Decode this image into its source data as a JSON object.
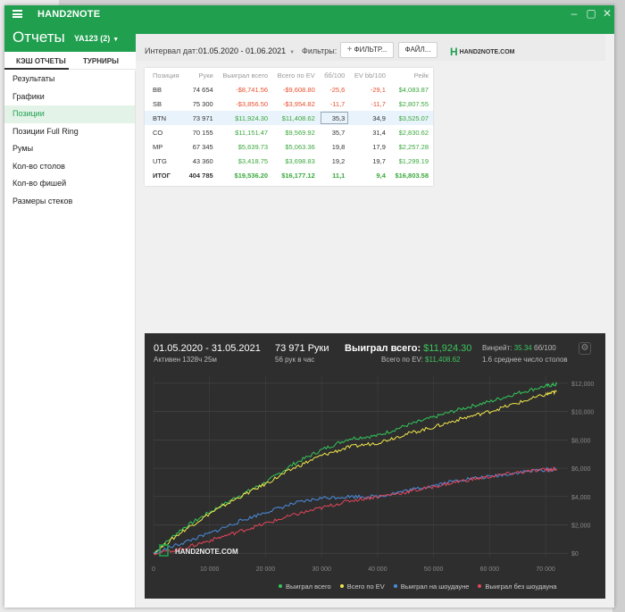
{
  "window": {
    "app_name": "HAND2NOTE",
    "page_title": "Отчеты",
    "account": "YA123 (2)",
    "controls": [
      "–",
      "▢",
      "✕"
    ]
  },
  "tabs": [
    {
      "label": "КЭШ ОТЧЕТЫ",
      "active": true
    },
    {
      "label": "ТУРНИРЫ",
      "active": false
    }
  ],
  "sidebar": {
    "items": [
      {
        "label": "Результаты",
        "active": false
      },
      {
        "label": "Графики",
        "active": false
      },
      {
        "label": "Позиции",
        "active": true
      },
      {
        "label": "Позиции Full Ring",
        "active": false
      },
      {
        "label": "Румы",
        "active": false
      },
      {
        "label": "Кол-во столов",
        "active": false
      },
      {
        "label": "Кол-во фишей",
        "active": false
      },
      {
        "label": "Размеры стеков",
        "active": false
      }
    ]
  },
  "toolbar": {
    "date_label": "Интервал дат:",
    "date_value": "01.05.2020 - 01.06.2021",
    "filters_label": "Фильтры:",
    "filter_button": "ФИЛЬТР...",
    "file_button": "ФАЙЛ...",
    "logo_text": "HAND2NOTE.COM"
  },
  "table": {
    "columns": [
      "Позиция",
      "Руки",
      "Выиграл всего",
      "Всего по EV",
      "бб/100",
      "EV bb/100",
      "Рейк"
    ],
    "rows": [
      [
        "BB",
        "74 654",
        "-$8,741.56",
        "-$9,608.80",
        "-25,6",
        "-29,1",
        "$4,083.87"
      ],
      [
        "SB",
        "75 300",
        "-$3,856.50",
        "-$3,954.82",
        "-11,7",
        "-11,7",
        "$2,807.55"
      ],
      [
        "BTN",
        "73 971",
        "$11,924.30",
        "$11,408.62",
        "35,3",
        "34,9",
        "$3,525.07"
      ],
      [
        "CO",
        "70 155",
        "$11,151.47",
        "$9,569.92",
        "35,7",
        "31,4",
        "$2,830.62"
      ],
      [
        "MP",
        "67 345",
        "$5,639.73",
        "$5,063.36",
        "19,8",
        "17,9",
        "$2,257.28"
      ],
      [
        "UTG",
        "43 360",
        "$3,418.75",
        "$3,698.83",
        "19,2",
        "19,7",
        "$1,299.19"
      ]
    ],
    "total": [
      "ИТОГ",
      "404 785",
      "$19,536.20",
      "$16,177.12",
      "11,1",
      "9,4",
      "$16,803.58"
    ],
    "selected_row": 2
  },
  "summary": {
    "period": "01.05.2020 - 31.05.2021",
    "active": "Активен 1328ч 25м",
    "hands": "73 971 Руки",
    "hands_per_hour": "56 рук в час",
    "won_label": "Выиграл всего:",
    "won_value": "$11,924.30",
    "ev_label": "Всего по EV:",
    "ev_value": "$11,408.62",
    "winrate_label": "Винрейт:",
    "winrate_value": "35.34",
    "winrate_unit": "бб/100",
    "tables": "1.6 среднее число столов",
    "watermark": "HAND2NOTE.COM"
  },
  "chart_data": {
    "type": "line",
    "x_ticks": [
      "0",
      "10 000",
      "20 000",
      "30 000",
      "40 000",
      "50 000",
      "60 000",
      "70 000"
    ],
    "y_ticks": [
      "$0",
      "$2,000",
      "$4,000",
      "$6,000",
      "$8,000",
      "$10,000",
      "$12,000"
    ],
    "xlim": [
      0,
      73971
    ],
    "ylim": [
      -300,
      12500
    ],
    "grid": true,
    "legend_position": "bottom-right",
    "series": [
      {
        "name": "Выиграл всего",
        "color": "#33c65a",
        "x": [
          0,
          5000,
          10000,
          15000,
          20000,
          25000,
          30000,
          35000,
          40000,
          45000,
          50000,
          55000,
          60000,
          65000,
          70000,
          72000
        ],
        "y": [
          0,
          1700,
          2900,
          4000,
          5000,
          6300,
          7300,
          8100,
          8300,
          9000,
          9600,
          10200,
          10700,
          11300,
          11800,
          11924
        ]
      },
      {
        "name": "Всего по EV",
        "color": "#f2e84c",
        "x": [
          0,
          5000,
          10000,
          15000,
          20000,
          25000,
          30000,
          35000,
          40000,
          45000,
          50000,
          55000,
          60000,
          65000,
          70000,
          72000
        ],
        "y": [
          0,
          1500,
          2800,
          3900,
          4900,
          6000,
          6900,
          7500,
          7800,
          8400,
          8900,
          9500,
          10000,
          10600,
          11200,
          11408
        ]
      },
      {
        "name": "Выиграл на шоудауне",
        "color": "#4a8de0",
        "x": [
          0,
          5000,
          10000,
          15000,
          20000,
          25000,
          30000,
          35000,
          40000,
          45000,
          50000,
          55000,
          60000,
          65000,
          70000,
          72000
        ],
        "y": [
          0,
          700,
          1400,
          2200,
          2900,
          3500,
          3900,
          4000,
          4000,
          4400,
          4800,
          5200,
          5400,
          5700,
          5900,
          5900
        ]
      },
      {
        "name": "Выиграл без шоудауна",
        "color": "#e3465a",
        "x": [
          0,
          5000,
          10000,
          15000,
          20000,
          25000,
          30000,
          35000,
          40000,
          45000,
          50000,
          55000,
          60000,
          65000,
          70000,
          72000
        ],
        "y": [
          0,
          300,
          900,
          1500,
          2100,
          2700,
          3200,
          3700,
          4000,
          4300,
          4700,
          5100,
          5400,
          5700,
          5900,
          5950
        ]
      }
    ]
  }
}
